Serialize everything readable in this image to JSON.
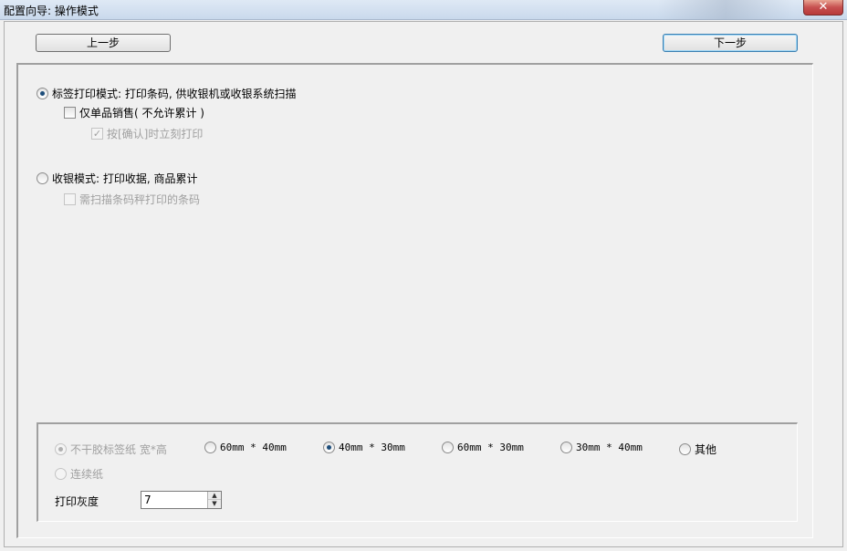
{
  "window": {
    "title": "配置向导: 操作模式",
    "close_glyph": "✕"
  },
  "nav": {
    "prev_label": "上一步",
    "next_label": "下一步"
  },
  "modes": {
    "label_mode": {
      "label": "标签打印模式: 打印条码, 供收银机或收银系统扫描",
      "selected": true,
      "single_item": {
        "label": "仅单品销售( 不允许累计 )",
        "checked": false
      },
      "confirm_print": {
        "label": "按[确认]时立刻打印",
        "checked": true,
        "disabled": true
      }
    },
    "cash_mode": {
      "label": "收银模式: 打印收据, 商品累计",
      "selected": false,
      "scan_barcode": {
        "label": "需扫描条码秤打印的条码",
        "checked": false,
        "disabled": true
      }
    }
  },
  "paper": {
    "options": [
      {
        "label": "不干胶标签纸 宽*高",
        "selected": true,
        "disabled": true
      },
      {
        "label": "60mm * 40mm",
        "selected": false,
        "disabled": false
      },
      {
        "label": "40mm * 30mm",
        "selected": true,
        "disabled": false
      },
      {
        "label": "60mm * 30mm",
        "selected": false,
        "disabled": false
      },
      {
        "label": "30mm * 40mm",
        "selected": false,
        "disabled": false
      },
      {
        "label": "其他",
        "selected": false,
        "disabled": false
      }
    ],
    "continuous": {
      "label": "连续纸",
      "selected": false,
      "disabled": true
    }
  },
  "gray": {
    "label": "打印灰度",
    "value": "7",
    "up_glyph": "▲",
    "down_glyph": "▼"
  }
}
